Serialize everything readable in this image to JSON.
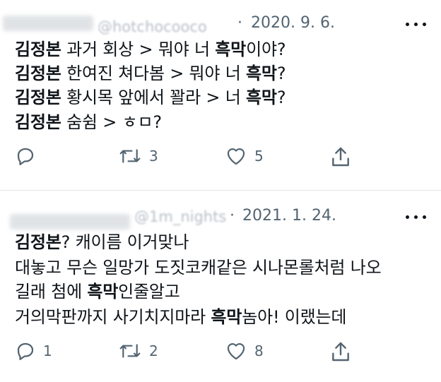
{
  "tweets": [
    {
      "handle": "@hotchocooco",
      "separator": "·",
      "date": "2020. 9. 6.",
      "lines": [
        [
          {
            "t": "김정본",
            "b": true
          },
          {
            "t": " 과거 회상 > 뭐야 너 ",
            "b": false
          },
          {
            "t": "흑막",
            "b": true
          },
          {
            "t": "이야?",
            "b": false
          }
        ],
        [
          {
            "t": "김정본",
            "b": true
          },
          {
            "t": " 한여진 쳐다봄 > 뭐야 너 ",
            "b": false
          },
          {
            "t": "흑막",
            "b": true
          },
          {
            "t": "?",
            "b": false
          }
        ],
        [
          {
            "t": "김정본",
            "b": true
          },
          {
            "t": " 황시목 앞에서 꽐라 > 너 ",
            "b": false
          },
          {
            "t": "흑막",
            "b": true
          },
          {
            "t": "?",
            "b": false
          }
        ],
        [
          {
            "t": "김정본",
            "b": true
          },
          {
            "t": " 숨쉼 > ㅎㅁ?",
            "b": false
          }
        ]
      ],
      "replies": "",
      "retweets": "3",
      "likes": "5"
    },
    {
      "handle": "@1m_nights",
      "separator": "·",
      "date": "2021. 1. 24.",
      "lines": [
        [
          {
            "t": "김정본",
            "b": true
          },
          {
            "t": "? 캐이름 이거맞나",
            "b": false
          }
        ],
        [
          {
            "t": "대놓고 무슨 일망가 도짓코캐같은 시나몬롤처럼 나오",
            "b": false
          }
        ],
        [
          {
            "t": "길래 첨에 ",
            "b": false
          },
          {
            "t": "흑막",
            "b": true
          },
          {
            "t": "인줄알고",
            "b": false
          }
        ],
        [
          {
            "t": "거의막판까지 사기치지마라 ",
            "b": false
          },
          {
            "t": "흑막",
            "b": true
          },
          {
            "t": "놈아! 이랬는데",
            "b": false
          }
        ]
      ],
      "replies": "1",
      "retweets": "2",
      "likes": "8"
    }
  ],
  "icons": {
    "reply": "reply-icon",
    "retweet": "retweet-icon",
    "like": "heart-icon",
    "share": "share-icon",
    "more": "more-icon"
  },
  "colors": {
    "text": "#0f1419",
    "muted": "#536471",
    "divider": "#e1e5e9"
  }
}
